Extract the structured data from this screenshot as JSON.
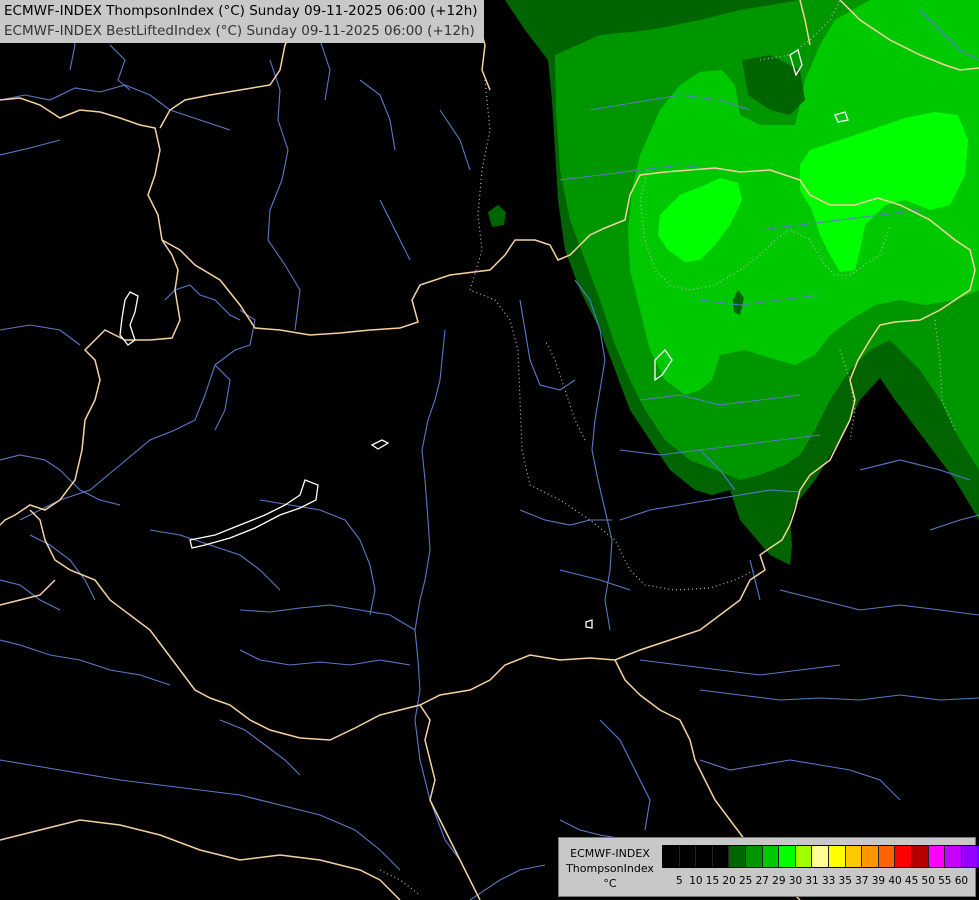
{
  "title": {
    "line1": "ECMWF-INDEX ThompsonIndex (°C) Sunday 09-11-2025 06:00 (+12h)",
    "line2": "ECMWF-INDEX BestLiftedIndex (°C) Sunday 09-11-2025 06:00 (+12h)"
  },
  "legend": {
    "model": "ECMWF-INDEX",
    "parameter": "ThompsonIndex",
    "unit": "°C",
    "colors": [
      "#000000",
      "#000000",
      "#000000",
      "#000000",
      "#006400",
      "#009600",
      "#00c800",
      "#00ff00",
      "#a0ff00",
      "#ffff96",
      "#ffff00",
      "#ffc800",
      "#ff9600",
      "#ff6400",
      "#ff0000",
      "#b40000",
      "#ff00ff",
      "#c800ff",
      "#9600ff",
      "#6400ff",
      "#0000ff"
    ],
    "ticks": [
      "5",
      "10",
      "15",
      "20",
      "25",
      "27",
      "29",
      "30",
      "31",
      "33",
      "35",
      "37",
      "39",
      "40",
      "45",
      "50",
      "55",
      "60"
    ]
  },
  "map": {
    "colors": {
      "background": "#000000",
      "level_25": "#006400",
      "level_27": "#009600",
      "level_29": "#00c800",
      "level_30": "#00ff00",
      "border": "#f5d2a0",
      "river": "#5a7ac8",
      "lake": "#ffffff",
      "bli_contour": "#bbbbbb"
    }
  }
}
